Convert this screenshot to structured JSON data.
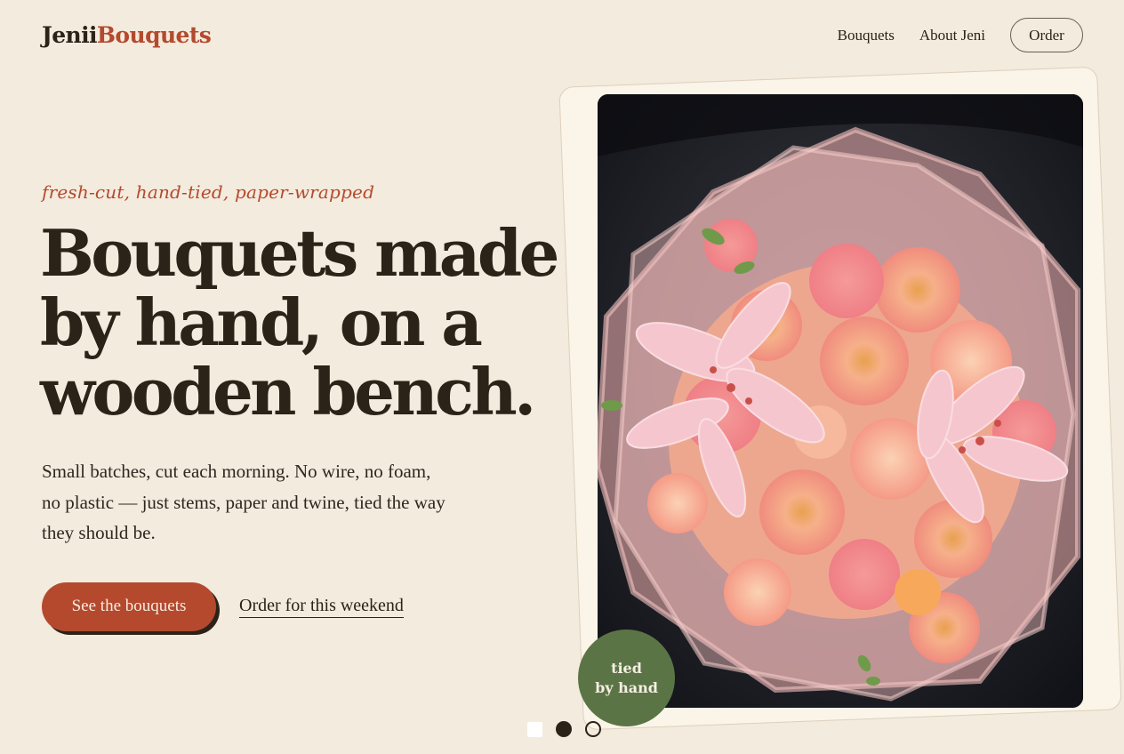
{
  "header": {
    "logo_part1": "Jenii",
    "logo_part2": "Bouquets",
    "nav": [
      "Bouquets",
      "About Jeni"
    ],
    "order_label": "Order"
  },
  "hero": {
    "tagline": "fresh-cut, hand-tied, paper-wrapped",
    "headline_lines": [
      "Bouquets made",
      "by hand, on a",
      "wooden bench."
    ],
    "lede": "Small batches, cut each morning. No wire, no foam, no plastic — just stems, paper and twine, tied the way they should be.",
    "cta_primary": "See the bouquets",
    "cta_secondary": "Order for this weekend"
  },
  "badge": {
    "line1": "tied",
    "line2": "by hand"
  },
  "carousel": {
    "dots": [
      "square",
      "filled",
      "ring"
    ],
    "active_index": 1
  },
  "colors": {
    "background": "#f3ebdd",
    "ink": "#2b2218",
    "accent": "#b4492e",
    "badge_green": "#5b7446",
    "card": "#fbf4e8"
  }
}
